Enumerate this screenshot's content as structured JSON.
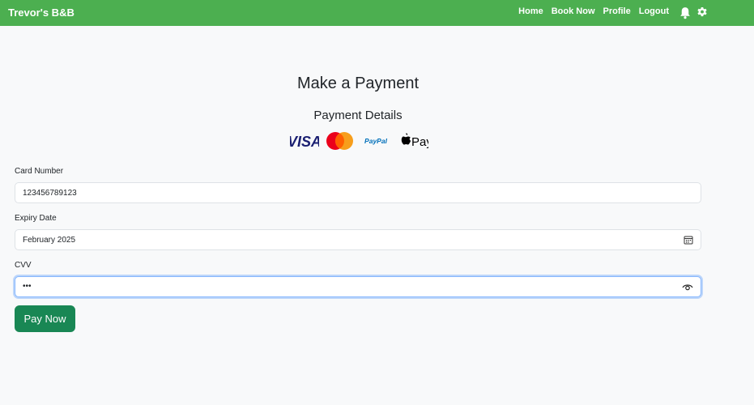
{
  "navbar": {
    "brand": "Trevor's B&B",
    "links": [
      {
        "label": "Home"
      },
      {
        "label": "Book Now"
      },
      {
        "label": "Profile"
      },
      {
        "label": "Logout"
      }
    ],
    "icons": [
      "bell-icon",
      "gear-icon"
    ]
  },
  "page": {
    "title": "Make a Payment",
    "subtitle": "Payment Details"
  },
  "logos": {
    "visa": "VISA",
    "paypal": "PayPal",
    "applepay": "Pay"
  },
  "form": {
    "card_number": {
      "label": "Card Number",
      "value": "123456789123"
    },
    "expiry": {
      "label": "Expiry Date",
      "value": "February 2025"
    },
    "cvv": {
      "label": "CVV",
      "value": "•••"
    },
    "submit_label": "Pay Now"
  },
  "colors": {
    "navbar": "#4caf50",
    "button": "#198754",
    "background": "#f8f9fa"
  }
}
